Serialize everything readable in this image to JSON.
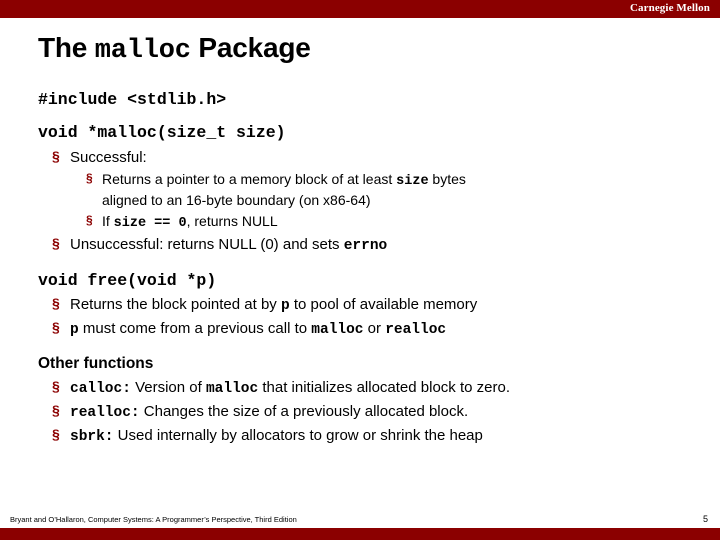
{
  "banner": {
    "brand": "Carnegie Mellon"
  },
  "title": {
    "before": "The ",
    "mono": "malloc",
    "after": " Package"
  },
  "content": {
    "include_line": "#include <stdlib.h>",
    "malloc_sig": "void *malloc(size_t size)",
    "malloc_success_label": "Successful:",
    "malloc_success_items": [
      {
        "parts": [
          {
            "t": "Returns a pointer to a memory block of at least ",
            "code": false
          },
          {
            "t": "size",
            "code": true
          },
          {
            "t": " bytes",
            "code": false
          }
        ],
        "line2": "aligned to an 16-byte boundary (on x86-64)"
      },
      {
        "parts": [
          {
            "t": "If ",
            "code": false
          },
          {
            "t": "size == 0",
            "code": true
          },
          {
            "t": ", returns NULL",
            "code": false
          }
        ],
        "line2": ""
      }
    ],
    "malloc_unsuccessful": [
      {
        "t": "Unsuccessful: returns NULL (0) and sets ",
        "code": false
      },
      {
        "t": "errno",
        "code": true
      }
    ],
    "free_sig": "void free(void *p)",
    "free_items": [
      [
        {
          "t": "Returns the block pointed at by ",
          "code": false
        },
        {
          "t": "p",
          "code": true
        },
        {
          "t": " to pool of available memory",
          "code": false
        }
      ],
      [
        {
          "t": "p",
          "code": true
        },
        {
          "t": " must come from a previous call to ",
          "code": false
        },
        {
          "t": "malloc",
          "code": true
        },
        {
          "t": "  or ",
          "code": false
        },
        {
          "t": "realloc",
          "code": true
        }
      ]
    ],
    "other_functions_heading": "Other functions",
    "other_functions": [
      [
        {
          "t": "calloc:",
          "code": true
        },
        {
          "t": " Version of ",
          "code": false
        },
        {
          "t": "malloc",
          "code": true
        },
        {
          "t": " that initializes allocated block to zero.",
          "code": false
        }
      ],
      [
        {
          "t": "realloc:",
          "code": true
        },
        {
          "t": " Changes the size of a previously allocated block.",
          "code": false
        }
      ],
      [
        {
          "t": "sbrk:",
          "code": true
        },
        {
          "t": " Used internally by allocators to grow or shrink the heap",
          "code": false
        }
      ]
    ]
  },
  "footer": {
    "citation": "Bryant and O’Hallaron, Computer Systems: A Programmer’s Perspective, Third Edition",
    "page_number": "5"
  },
  "colors": {
    "banner": "#8B0000",
    "bullet": "#8B0000",
    "text": "#000000"
  },
  "icons": {
    "bullet_glyph": "§"
  }
}
